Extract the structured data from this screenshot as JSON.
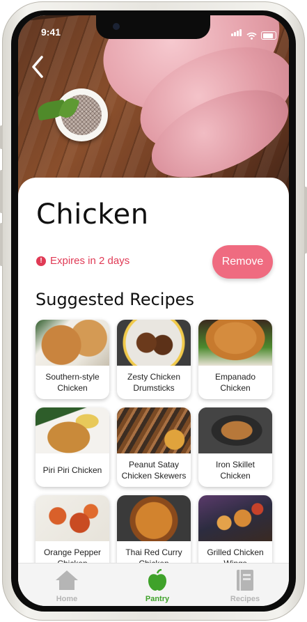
{
  "status_bar": {
    "time": "9:41"
  },
  "header": {
    "back_icon": "chevron-left-icon"
  },
  "item": {
    "name": "Chicken",
    "expiry_text": "Expires in 2 days",
    "expiry_icon": "alert-circle-icon",
    "remove_label": "Remove"
  },
  "recipes": {
    "heading": "Suggested Recipes",
    "items": [
      {
        "label": "Southern-style Chicken"
      },
      {
        "label": "Zesty Chicken Drumsticks"
      },
      {
        "label": "Empanado Chicken"
      },
      {
        "label": "Piri Piri Chicken"
      },
      {
        "label": "Peanut Satay Chicken Skewers"
      },
      {
        "label": "Iron Skillet Chicken"
      },
      {
        "label": "Orange Pepper Chicken"
      },
      {
        "label": "Thai Red Curry Chicken"
      },
      {
        "label": "Grilled Chicken Wings"
      }
    ]
  },
  "tabs": [
    {
      "label": "Home",
      "icon": "home-icon",
      "active": false
    },
    {
      "label": "Pantry",
      "icon": "apple-icon",
      "active": true
    },
    {
      "label": "Recipes",
      "icon": "recipe-book-icon",
      "active": false
    }
  ],
  "colors": {
    "accent_red": "#e03a55",
    "remove_button": "#ef6b80",
    "active_tab": "#3fa22a",
    "inactive_tab": "#b5b5b5"
  }
}
